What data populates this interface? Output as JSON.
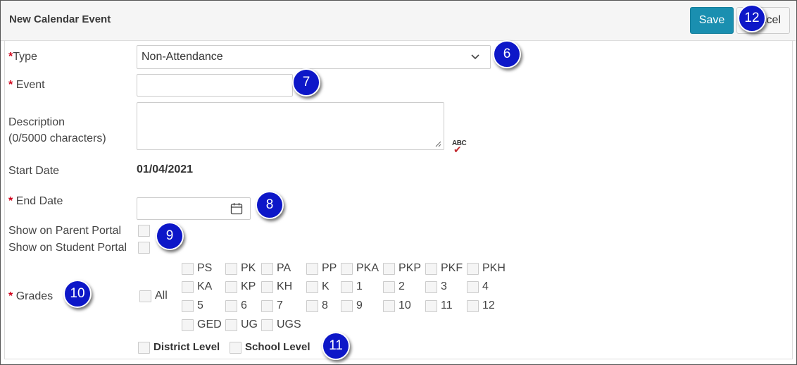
{
  "header": {
    "title": "New Calendar Event",
    "save_label": "Save",
    "cancel_label": "Cancel"
  },
  "form": {
    "type": {
      "label": "Type",
      "value": "Non-Attendance"
    },
    "event": {
      "label": "Event",
      "value": ""
    },
    "description": {
      "label": "Description",
      "counter": "(0/5000 characters)",
      "value": ""
    },
    "start_date": {
      "label": "Start Date",
      "value": "01/04/2021"
    },
    "end_date": {
      "label": "End Date",
      "value": ""
    },
    "parent_portal": {
      "label": "Show on Parent Portal"
    },
    "student_portal": {
      "label": "Show on Student Portal"
    },
    "grades": {
      "label": "Grades",
      "all_label": "All",
      "items": [
        "PS",
        "PK",
        "PA",
        "PP",
        "PKA",
        "PKP",
        "PKF",
        "PKH",
        "KA",
        "KP",
        "KH",
        "K",
        "1",
        "2",
        "3",
        "4",
        "5",
        "6",
        "7",
        "8",
        "9",
        "10",
        "11",
        "12",
        "GED",
        "UG",
        "UGS"
      ]
    },
    "district_level": "District Level",
    "school_level": "School Level",
    "required_mark": "*",
    "spellcheck": "ABC"
  },
  "callouts": [
    "6",
    "7",
    "8",
    "9",
    "10",
    "11",
    "12"
  ],
  "colors": {
    "accent": "#1a8fb0",
    "required": "#d0021b",
    "callout": "#0d17c8"
  }
}
